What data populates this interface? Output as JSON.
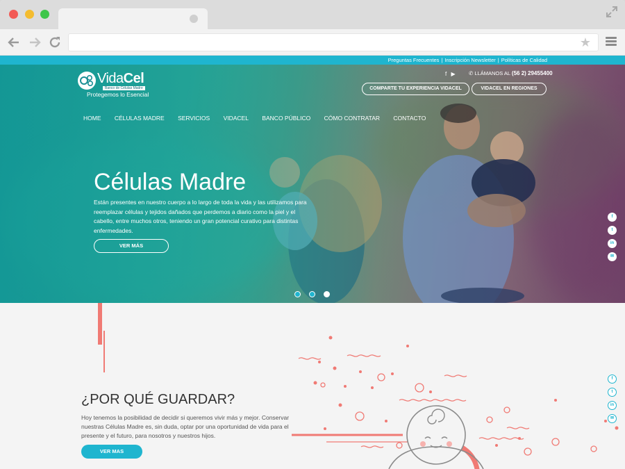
{
  "browser": {
    "tab_title": "",
    "url": ""
  },
  "top_links": [
    "Preguntas Frecuentes",
    "Inscripción Newsletter",
    "Políticas de Calidad"
  ],
  "header": {
    "logo_name_light": "Vida",
    "logo_name_bold": "Cel",
    "logo_subtitle": "Banco de Células Madre",
    "logo_tagline": "Protegemos lo Esencial",
    "phone_label": "LLÁMANOS AL",
    "phone_number": "(56 2) 29455400",
    "cta_share": "COMPARTE TU EXPERIENCIA VIDACEL",
    "cta_regions": "VIDACEL EN REGIONES"
  },
  "nav": [
    "HOME",
    "CÉLULAS MADRE",
    "SERVICIOS",
    "VIDACEL",
    "BANCO PÚBLICO",
    "CÓMO CONTRATAR",
    "CONTACTO"
  ],
  "hero": {
    "title": "Células Madre",
    "text": "Están presentes en nuestro cuerpo a lo largo de toda la vida y las utilizamos para reemplazar células y tejidos dañados que perdemos a diario como la piel y el cabello, entre muchos otros, teniendo un gran potencial curativo para distintas enfermedades.",
    "button": "VER MÁS",
    "slides_total": 3,
    "active_slide": 3
  },
  "why": {
    "title": "¿POR QUÉ GUARDAR?",
    "text": "Hoy tenemos la posibilidad de decidir si queremos vivir más y mejor. Conservar nuestras Células Madre es, sin duda, optar por una oportunidad de vida para el presente y el futuro, para nosotros y nuestros hijos.",
    "button": "VER MAS"
  },
  "social_icons": [
    "facebook-icon",
    "twitter-icon",
    "linkedin-icon",
    "email-icon"
  ],
  "colors": {
    "accent": "#1fb5cf",
    "coral": "#f07a74",
    "text_dark": "#333333"
  }
}
